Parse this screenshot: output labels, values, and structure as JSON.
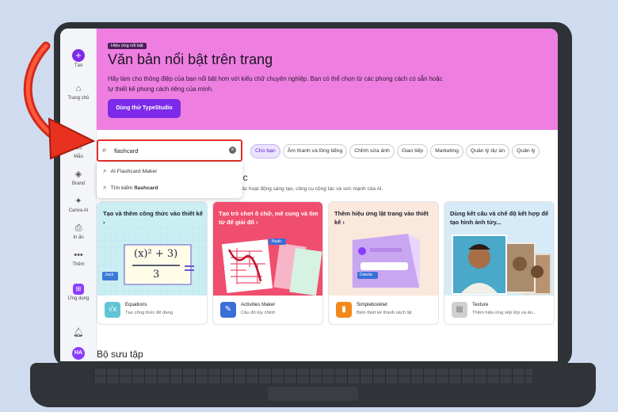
{
  "sidebar": {
    "items": [
      {
        "icon": "plus-icon",
        "label": "Tạo"
      },
      {
        "icon": "home-icon",
        "label": "Trang chủ"
      },
      {
        "icon": "template-icon",
        "label": "Mẫu"
      },
      {
        "icon": "brand-icon",
        "label": "Brand"
      },
      {
        "icon": "canva-ai-icon",
        "label": "Canva AI"
      },
      {
        "icon": "print-icon",
        "label": "In ấn"
      },
      {
        "icon": "more-icon",
        "label": "Thêm"
      },
      {
        "icon": "apps-icon",
        "label": "Ứng dụng"
      }
    ],
    "avatar_initials": "HA"
  },
  "hero": {
    "badge": "Hiệu ứng nổi bật",
    "title": "Văn bản nổi bật trên trang",
    "description": "Hãy làm cho thông điệp của bạn nổi bật hơn với kiểu chữ chuyên nghiệp. Bạn có thể chọn từ các phong cách có sẵn hoặc tự thiết kế phong cách riêng của mình.",
    "cta_label": "Dùng thử TypeStudio",
    "background": "#ee7fe0"
  },
  "search": {
    "value": "flashcard",
    "suggestions": [
      {
        "text": "AI Flashcard Maker"
      },
      {
        "prefix": "Tìm kiếm ",
        "bold": "flashcard"
      }
    ]
  },
  "chips": [
    "Cho bạn",
    "Âm thanh và lồng tiếng",
    "Chỉnh sửa ảnh",
    "Giao tiếp",
    "Marketing",
    "Quản lý dự án",
    "Quản lý"
  ],
  "section": {
    "title_fragment": "ục",
    "subtitle": "các hoạt động sáng tạo, công cụ cộng tác và sức mạnh của AI."
  },
  "cards": [
    {
      "title": "Tạo và thêm công thức vào thiết kế ›",
      "name": "Equations",
      "desc": "Tạo công thức để dàng",
      "bg": "#cbeef3",
      "icon": "sqrt-icon",
      "iconbg": "#62c4d4",
      "jack": "Jack"
    },
    {
      "title": "Tạo trò chơi ô chữ, mê cung và tìm từ để giải đố ›",
      "name": "Activities Maker",
      "desc": "Câu đố tùy chỉnh",
      "bg": "#f04e6e",
      "icon": "puzzle-icon",
      "iconbg": "#3b6fd8",
      "tag": "Noah"
    },
    {
      "title": "Thêm hiệu ứng lật trang vào thiết kế ›",
      "name": "Simplebooklet",
      "desc": "Biến thiết kế thành sách lật",
      "bg": "#fbe8dd",
      "icon": "book-icon",
      "iconbg": "#f28a1b",
      "tag": "Dakota"
    },
    {
      "title": "Dùng kết cấu và chế độ kết hợp để tạo hình ảnh từy...",
      "name": "Texture",
      "desc": "Thêm hiệu ứng xếp lớp và ản...",
      "bg": "#d6ebf7",
      "icon": "texture-icon",
      "iconbg": "#cfcfcf"
    }
  ],
  "collections_title": "Bộ sưu tập",
  "formula": {
    "top": "(x)² + 3)",
    "bottom": "3"
  }
}
